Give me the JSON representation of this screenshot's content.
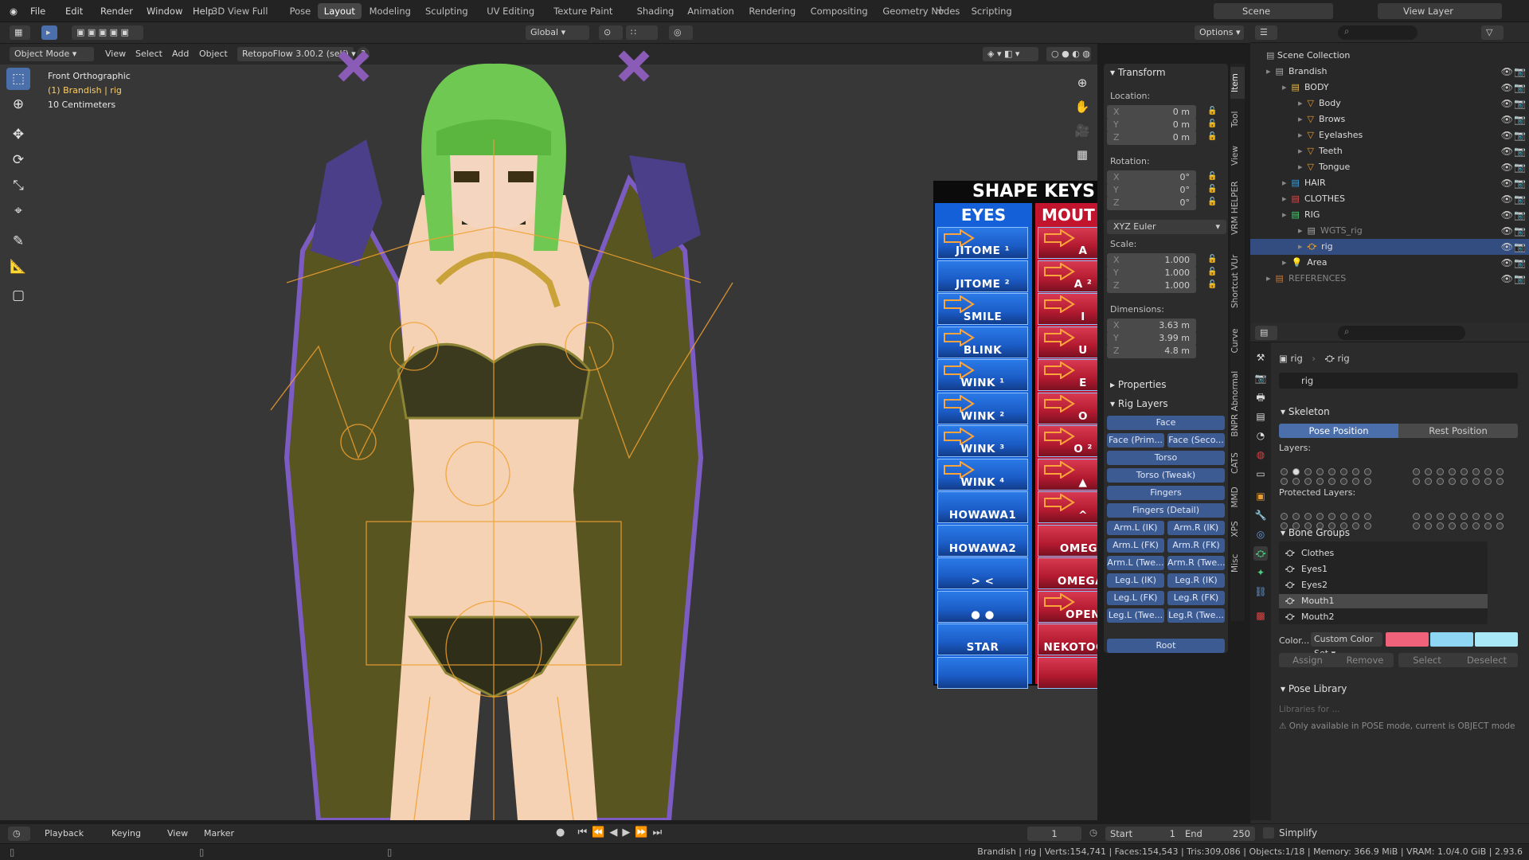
{
  "topbar": {
    "menus": [
      "File",
      "Edit",
      "Render",
      "Window",
      "Help"
    ],
    "workspaces": [
      "3D View Full",
      "Pose",
      "Layout",
      "Modeling",
      "Sculpting",
      "UV Editing",
      "Texture Paint",
      "Shading",
      "Animation",
      "Rendering",
      "Compositing",
      "Geometry Nodes",
      "Scripting"
    ],
    "active_workspace": "Layout",
    "scene": "Scene",
    "view_layer": "View Layer"
  },
  "viewport_header": {
    "mode": "Object Mode",
    "menus": [
      "View",
      "Select",
      "Add",
      "Object"
    ],
    "addon": "RetopoFlow 3.00.2 (self)",
    "orientation": "Global",
    "options": "Options"
  },
  "overlay": {
    "view_name": "Front Orthographic",
    "object": "(1) Brandish | rig",
    "scale": "10 Centimeters"
  },
  "shape_keys": {
    "title": "SHAPE KEYS",
    "eyes_header": "EYES",
    "mouth_header": "MOUT",
    "eyes": [
      "JITOME ¹",
      "JITOME ²",
      "SMILE",
      "BLINK",
      "WINK ¹",
      "WINK ²",
      "WINK ³",
      "WINK ⁴",
      "HOWAWA1",
      "HOWAWA2",
      "> <",
      "● ●",
      "STAR",
      ""
    ],
    "mouth": [
      "A",
      "A ²",
      "I",
      "U",
      "E",
      "O",
      "O ²",
      "▲",
      "^",
      "OMEGA",
      "OMEGA-",
      "OPEN",
      "NEKOTOOTH",
      ""
    ],
    "eyes_arrows": [
      true,
      false,
      true,
      true,
      true,
      true,
      true,
      true,
      false,
      false,
      false,
      false,
      false,
      false
    ],
    "mouth_arrows": [
      true,
      true,
      true,
      true,
      true,
      true,
      true,
      true,
      true,
      false,
      false,
      true,
      false,
      false
    ]
  },
  "npanel": {
    "transform": "Transform",
    "location_label": "Location:",
    "location": [
      {
        "k": "X",
        "v": "0 m"
      },
      {
        "k": "Y",
        "v": "0 m"
      },
      {
        "k": "Z",
        "v": "0 m"
      }
    ],
    "rotation_label": "Rotation:",
    "rotation": [
      {
        "k": "X",
        "v": "0°"
      },
      {
        "k": "Y",
        "v": "0°"
      },
      {
        "k": "Z",
        "v": "0°"
      }
    ],
    "rotation_mode": "XYZ Euler",
    "scale_label": "Scale:",
    "scale": [
      {
        "k": "X",
        "v": "1.000"
      },
      {
        "k": "Y",
        "v": "1.000"
      },
      {
        "k": "Z",
        "v": "1.000"
      }
    ],
    "dimensions_label": "Dimensions:",
    "dimensions": [
      {
        "k": "X",
        "v": "3.63 m"
      },
      {
        "k": "Y",
        "v": "3.99 m"
      },
      {
        "k": "Z",
        "v": "4.8 m"
      }
    ],
    "properties": "Properties",
    "rig_layers": "Rig Layers",
    "rig_buttons_full": [
      "Face"
    ],
    "rig_pairs_1": [
      "Face (Prim...",
      "Face (Seco..."
    ],
    "rig_buttons_full_2": [
      "Torso",
      "Torso (Tweak)",
      "Fingers",
      "Fingers (Detail)"
    ],
    "rig_pairs": [
      [
        "Arm.L (IK)",
        "Arm.R (IK)"
      ],
      [
        "Arm.L (FK)",
        "Arm.R (FK)"
      ],
      [
        "Arm.L (Twe...",
        "Arm.R (Twe..."
      ],
      [
        "Leg.L (IK)",
        "Leg.R (IK)"
      ],
      [
        "Leg.L (FK)",
        "Leg.R (FK)"
      ],
      [
        "Leg.L (Twe...",
        "Leg.R (Twe..."
      ]
    ],
    "root": "Root"
  },
  "vtabs": [
    "Item",
    "Tool",
    "View",
    "VRM HELPER",
    "Shortcut VUr",
    "Curve",
    "BNPR Abnormal",
    "CATS",
    "MMD",
    "XPS",
    "Misc"
  ],
  "outliner": {
    "root": "Scene Collection",
    "rows": [
      {
        "label": "Brandish",
        "indent": 1,
        "sel": false
      },
      {
        "label": "BODY",
        "indent": 2,
        "sel": false
      },
      {
        "label": "Body",
        "indent": 3,
        "sel": false
      },
      {
        "label": "Brows",
        "indent": 3,
        "sel": false
      },
      {
        "label": "Eyelashes",
        "indent": 3,
        "sel": false
      },
      {
        "label": "Teeth",
        "indent": 3,
        "sel": false
      },
      {
        "label": "Tongue",
        "indent": 3,
        "sel": false
      },
      {
        "label": "HAIR",
        "indent": 2,
        "sel": false
      },
      {
        "label": "CLOTHES",
        "indent": 2,
        "sel": false
      },
      {
        "label": "RIG",
        "indent": 2,
        "sel": false
      },
      {
        "label": "WGTS_rig",
        "indent": 3,
        "sel": false
      },
      {
        "label": "rig",
        "indent": 3,
        "sel": true
      },
      {
        "label": "Area",
        "indent": 2,
        "sel": false
      },
      {
        "label": "REFERENCES",
        "indent": 1,
        "sel": false
      }
    ]
  },
  "properties": {
    "object": "rig",
    "data": "rig",
    "data_field": "rig",
    "skeleton": "Skeleton",
    "pose_position": "Pose Position",
    "rest_position": "Rest Position",
    "layers_label": "Layers:",
    "protected_label": "Protected Layers:",
    "bone_groups": "Bone Groups",
    "groups": [
      "Clothes",
      "Eyes1",
      "Eyes2",
      "Mouth1",
      "Mouth2"
    ],
    "selected_group": "Mouth1",
    "color_label": "Color...",
    "color_set": "Custom Color Set",
    "swatches": [
      "#f0627a",
      "#8fd6f4",
      "#a9e8f7"
    ],
    "assign": "Assign",
    "remove": "Remove",
    "select": "Select",
    "deselect": "Deselect",
    "pose_library": "Pose Library",
    "libraries": "Libraries for ...",
    "warning": "Only available in POSE mode, current is OBJECT mode"
  },
  "timeline": {
    "menus": [
      "Playback",
      "Keying",
      "View",
      "Marker"
    ],
    "frame": "1",
    "start_label": "Start",
    "start": "1",
    "end_label": "End",
    "end": "250",
    "simplify": "Simplify"
  },
  "status": "Brandish | rig | Verts:154,741 | Faces:154,543 | Tris:309,086 | Objects:1/18 | Memory: 366.9 MiB | VRAM: 1.0/4.0 GiB | 2.93.6"
}
